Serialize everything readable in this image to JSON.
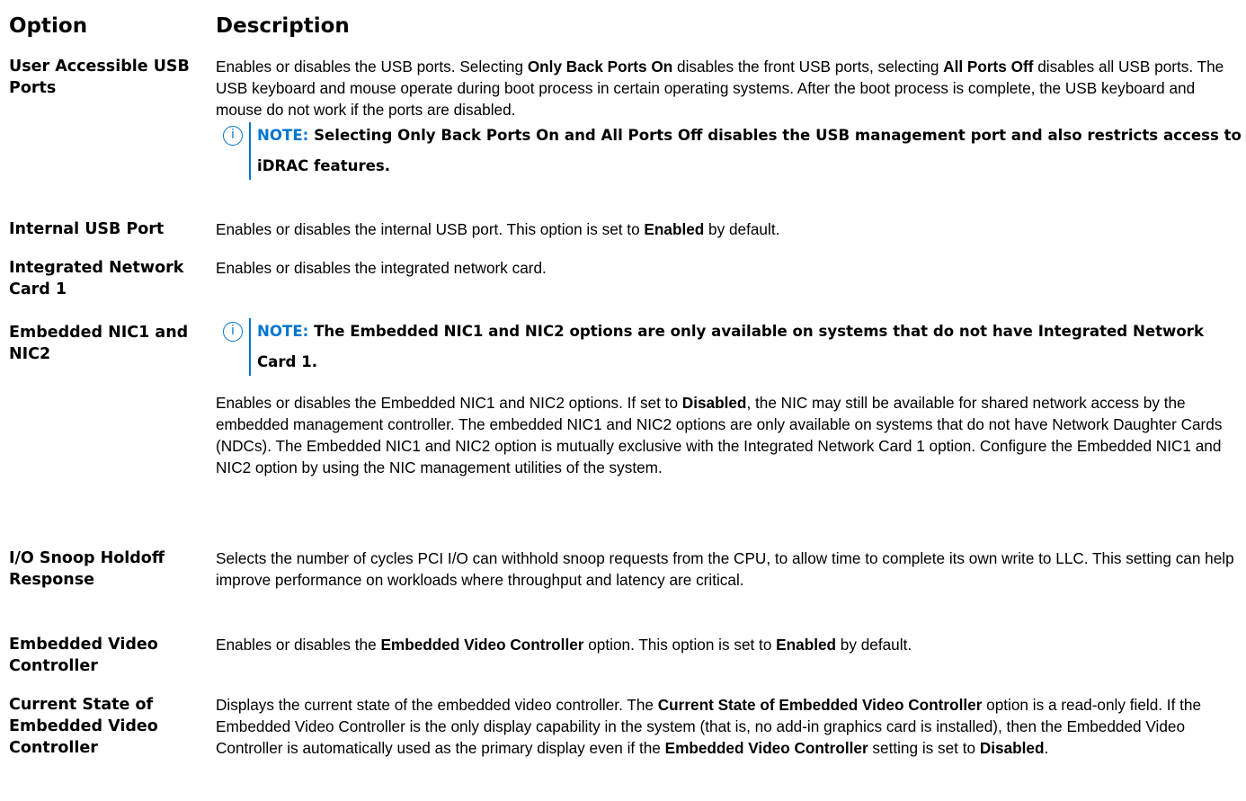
{
  "table": {
    "header": {
      "option": "Option",
      "description": "Description"
    },
    "rows": {
      "usb": {
        "option": "User Accessible USB Ports",
        "d1": "Enables or disables the USB ports. Selecting ",
        "b1": "Only Back Ports On",
        "d2": " disables the front USB ports, selecting ",
        "b2": "All Ports Off",
        "d3": " disables all USB ports. The USB keyboard and mouse operate during boot process in certain operating systems. After the boot process is complete, the USB keyboard and mouse do not work if the ports are disabled.",
        "note_label": "NOTE:",
        "note_text": " Selecting Only Back Ports On and All Ports Off disables the USB management port and also restricts access to iDRAC features."
      },
      "internal_usb": {
        "option": "Internal USB Port",
        "d1": "Enables or disables the internal USB port. This option is set to ",
        "b1": "Enabled",
        "d2": " by default."
      },
      "integrated_nic": {
        "option": "Integrated Network Card 1",
        "d1": "Enables or disables the integrated network card."
      },
      "embedded_nic": {
        "option": "Embedded NIC1 and NIC2",
        "note_label": "NOTE:",
        "note_text": " The Embedded NIC1 and NIC2 options are only available on systems that do not have Integrated Network Card 1.",
        "d1": "Enables or disables the Embedded NIC1 and NIC2 options. If set to ",
        "b1": "Disabled",
        "d2": ", the NIC may still be available for shared network access by the embedded management controller. The embedded NIC1 and NIC2 options are only available on systems that do not have Network Daughter Cards (NDCs). The Embedded NIC1 and NIC2 option is mutually exclusive with the Integrated Network Card 1 option. Configure the Embedded NIC1 and NIC2 option by using the NIC management utilities of the system."
      },
      "io_snoop": {
        "option": "I/O Snoop Holdoff Response",
        "d1": "Selects the number of cycles PCI I/O can withhold snoop requests from the CPU, to allow time to complete its own write to LLC. This setting can help improve performance on workloads where throughput and latency are critical."
      },
      "embedded_video": {
        "option": "Embedded Video Controller",
        "d1": "Enables or disables the ",
        "b1": "Embedded Video Controller",
        "d2": " option. This option is set to ",
        "b2": "Enabled",
        "d3": " by default."
      },
      "current_state": {
        "option": "Current State of Embedded Video Controller",
        "d1": "Displays the current state of the embedded video controller. The ",
        "b1": "Current State of Embedded Video Controller",
        "d2": " option is a read-only field. If the Embedded Video Controller is the only display capability in the system (that is, no add-in graphics card is installed), then the Embedded Video Controller is automatically used as the primary display even if the ",
        "b2": "Embedded Video Controller",
        "d3": " setting is set to ",
        "b3": "Disabled",
        "d4": "."
      }
    }
  },
  "icons": {
    "note": "info-icon",
    "note_accent": "#0076ce"
  }
}
